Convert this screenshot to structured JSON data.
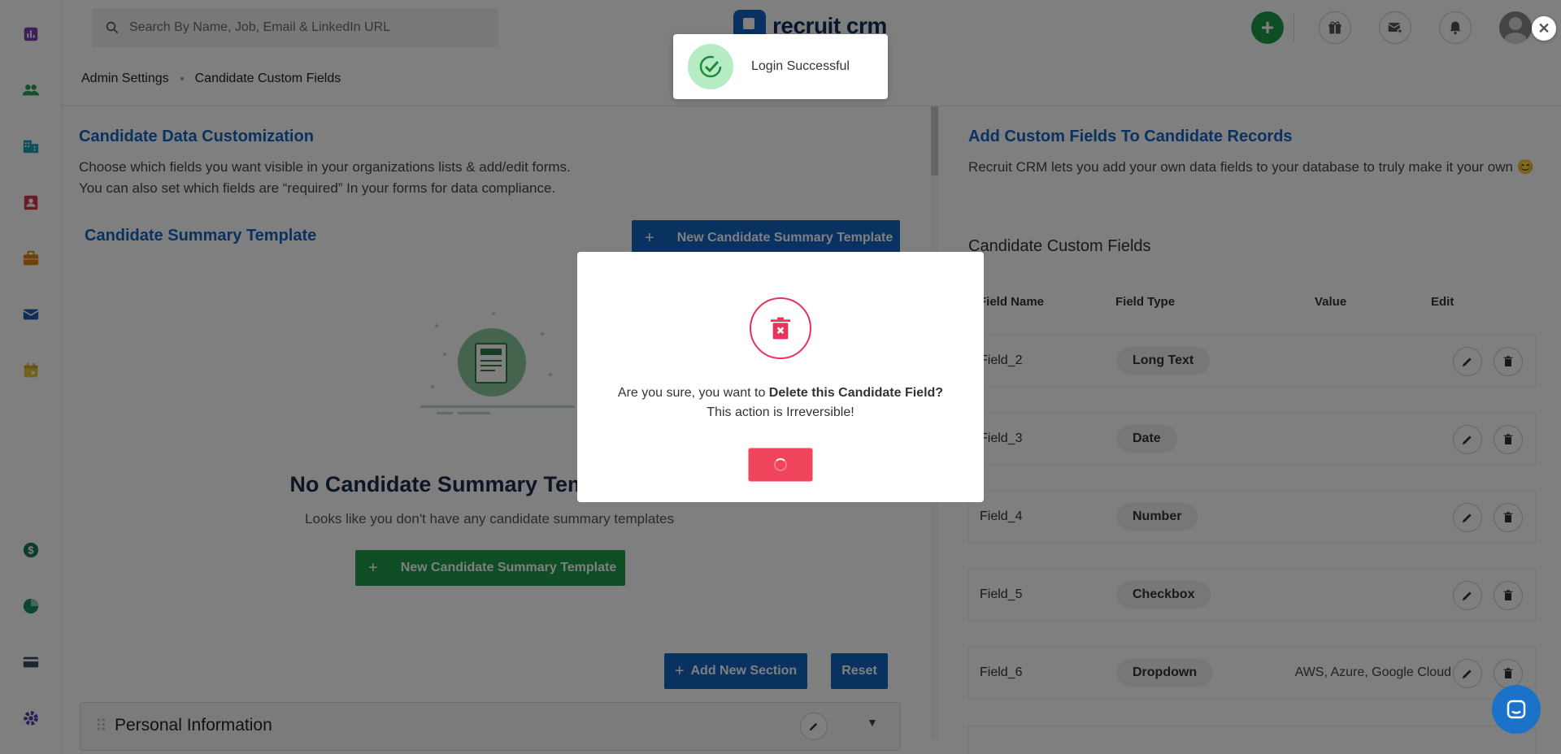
{
  "search": {
    "placeholder": "Search By Name, Job, Email & LinkedIn URL"
  },
  "logo": {
    "text": "recruit crm"
  },
  "breadcrumb": {
    "items": [
      "Admin Settings",
      "Candidate Custom Fields"
    ]
  },
  "left": {
    "title": "Candidate Data Customization",
    "desc_line1": "Choose which fields you want visible in your organizations lists & add/edit forms.",
    "desc_line2": "You can also set which fields are “required” In your forms for data compliance.",
    "summary_title": "Candidate Summary Template",
    "new_template_label": "New Candidate Summary Template",
    "empty_title": "No Candidate Summary Templates Yet",
    "empty_desc": "Looks like you don't have any candidate summary templates",
    "empty_btn_label": "New Candidate Summary Template",
    "add_section_label": "Add New Section",
    "reset_label": "Reset",
    "section_title": "Personal Information"
  },
  "right": {
    "title": "Add Custom Fields To Candidate Records",
    "desc": "Recruit CRM lets you add your own data fields to your database to truly make it your own 😊",
    "subtitle": "Candidate Custom Fields",
    "columns": [
      "Field Name",
      "Field Type",
      "Value",
      "Edit"
    ],
    "rows": [
      {
        "name": "Field_2",
        "type": "Long Text",
        "value": ""
      },
      {
        "name": "Field_3",
        "type": "Date",
        "value": ""
      },
      {
        "name": "Field_4",
        "type": "Number",
        "value": ""
      },
      {
        "name": "Field_5",
        "type": "Checkbox",
        "value": ""
      },
      {
        "name": "Field_6",
        "type": "Dropdown",
        "value": "AWS, Azure, Google Cloud"
      }
    ]
  },
  "modal": {
    "text_prefix": "Are you sure, you want to ",
    "text_bold": "Delete this Candidate Field?",
    "text_line2": "This action is Irreversible!"
  },
  "toast": {
    "message": "Login Successful"
  },
  "colors": {
    "brand_blue": "#1565c0",
    "green": "#1e9a4b",
    "danger": "#e8315b",
    "overlay": "rgba(0,0,0,0.5)"
  },
  "icons": {
    "sidebar": [
      "reports-icon",
      "contacts-icon",
      "companies-icon",
      "candidates-icon",
      "jobs-icon",
      "email-icon",
      "calendar-icon",
      "billing-icon",
      "analytics-icon",
      "card-icon",
      "settings-icon"
    ]
  }
}
